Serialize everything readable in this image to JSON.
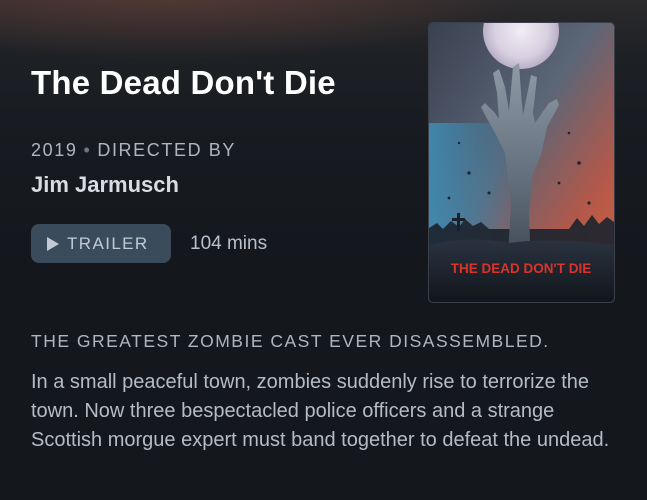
{
  "movie": {
    "title": "The Dead Don't Die",
    "year": "2019",
    "directed_by_label": "DIRECTED BY",
    "director": "Jim Jarmusch",
    "trailer_label": "TRAILER",
    "runtime": "104 mins",
    "tagline": "THE GREATEST ZOMBIE CAST EVER DISASSEMBLED.",
    "description": "In a small peaceful town, zombies suddenly rise to terrorize the town. Now three bespectacled police officers and a strange Scottish morgue expert must band together to defeat the undead."
  },
  "poster": {
    "title_text": "THE DEAD DON'T DIE"
  },
  "icons": {
    "trailer": "play-icon"
  },
  "colors": {
    "background": "#14181d",
    "button": "#3a4b5b",
    "poster_title": "#d9342b"
  }
}
